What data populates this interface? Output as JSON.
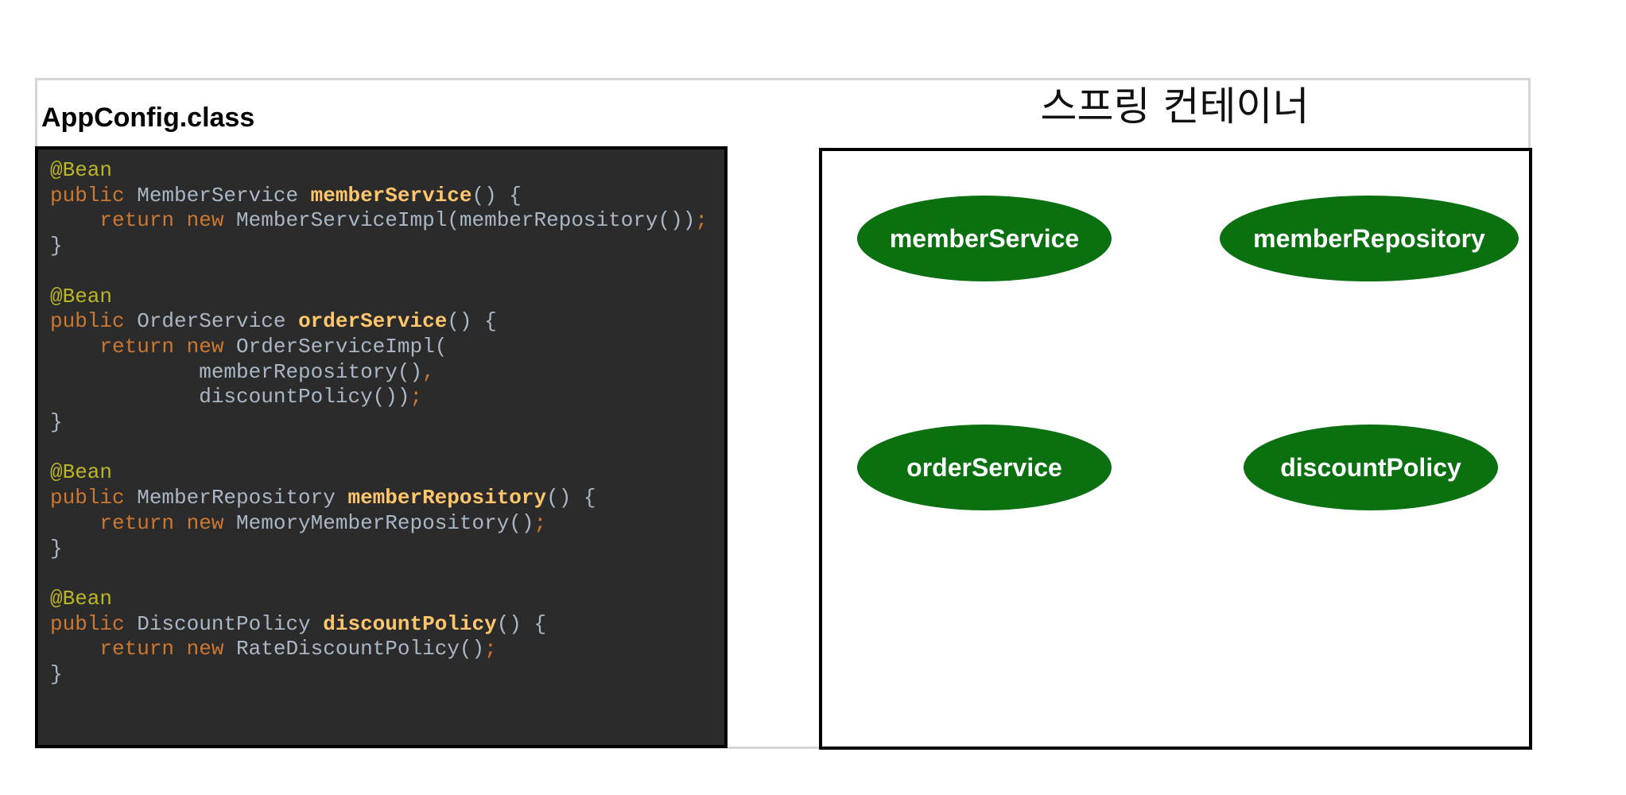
{
  "config": {
    "title": "AppConfig.class",
    "code_lines": [
      [
        {
          "t": "@Bean",
          "c": "ann"
        }
      ],
      [
        {
          "t": "public ",
          "c": "kw"
        },
        {
          "t": "MemberService ",
          "c": "type"
        },
        {
          "t": "memberService",
          "c": "fn"
        },
        {
          "t": "() {",
          "c": "punc"
        }
      ],
      [
        {
          "t": "    return new ",
          "c": "kw"
        },
        {
          "t": "MemberServiceImpl(memberRepository())",
          "c": "type"
        },
        {
          "t": ";",
          "c": "semi"
        }
      ],
      [
        {
          "t": "}",
          "c": "punc"
        }
      ],
      [],
      [
        {
          "t": "@Bean",
          "c": "ann"
        }
      ],
      [
        {
          "t": "public ",
          "c": "kw"
        },
        {
          "t": "OrderService ",
          "c": "type"
        },
        {
          "t": "orderService",
          "c": "fn"
        },
        {
          "t": "() {",
          "c": "punc"
        }
      ],
      [
        {
          "t": "    return new ",
          "c": "kw"
        },
        {
          "t": "OrderServiceImpl(",
          "c": "type"
        }
      ],
      [
        {
          "t": "            memberRepository()",
          "c": "type"
        },
        {
          "t": ",",
          "c": "semi"
        }
      ],
      [
        {
          "t": "            discountPolicy())",
          "c": "type"
        },
        {
          "t": ";",
          "c": "semi"
        }
      ],
      [
        {
          "t": "}",
          "c": "punc"
        }
      ],
      [],
      [
        {
          "t": "@Bean",
          "c": "ann"
        }
      ],
      [
        {
          "t": "public ",
          "c": "kw"
        },
        {
          "t": "MemberRepository ",
          "c": "type"
        },
        {
          "t": "memberRepository",
          "c": "fn"
        },
        {
          "t": "() {",
          "c": "punc"
        }
      ],
      [
        {
          "t": "    return new ",
          "c": "kw"
        },
        {
          "t": "MemoryMemberRepository()",
          "c": "type"
        },
        {
          "t": ";",
          "c": "semi"
        }
      ],
      [
        {
          "t": "}",
          "c": "punc"
        }
      ],
      [],
      [
        {
          "t": "@Bean",
          "c": "ann"
        }
      ],
      [
        {
          "t": "public ",
          "c": "kw"
        },
        {
          "t": "DiscountPolicy ",
          "c": "type"
        },
        {
          "t": "discountPolicy",
          "c": "fn"
        },
        {
          "t": "() {",
          "c": "punc"
        }
      ],
      [
        {
          "t": "    return new ",
          "c": "kw"
        },
        {
          "t": "RateDiscountPolicy()",
          "c": "type"
        },
        {
          "t": ";",
          "c": "semi"
        }
      ],
      [
        {
          "t": "}",
          "c": "punc"
        }
      ]
    ]
  },
  "container": {
    "title": "스프링 컨테이너",
    "beans": [
      {
        "name": "memberService"
      },
      {
        "name": "memberRepository"
      },
      {
        "name": "orderService"
      },
      {
        "name": "discountPolicy"
      }
    ]
  },
  "colors": {
    "code_background": "#2b2b2b",
    "bean_fill": "#0a7010",
    "annotation": "#bbb529",
    "keyword": "#cc7832",
    "method_name": "#ffc66d",
    "identifier": "#a9b7c6"
  }
}
